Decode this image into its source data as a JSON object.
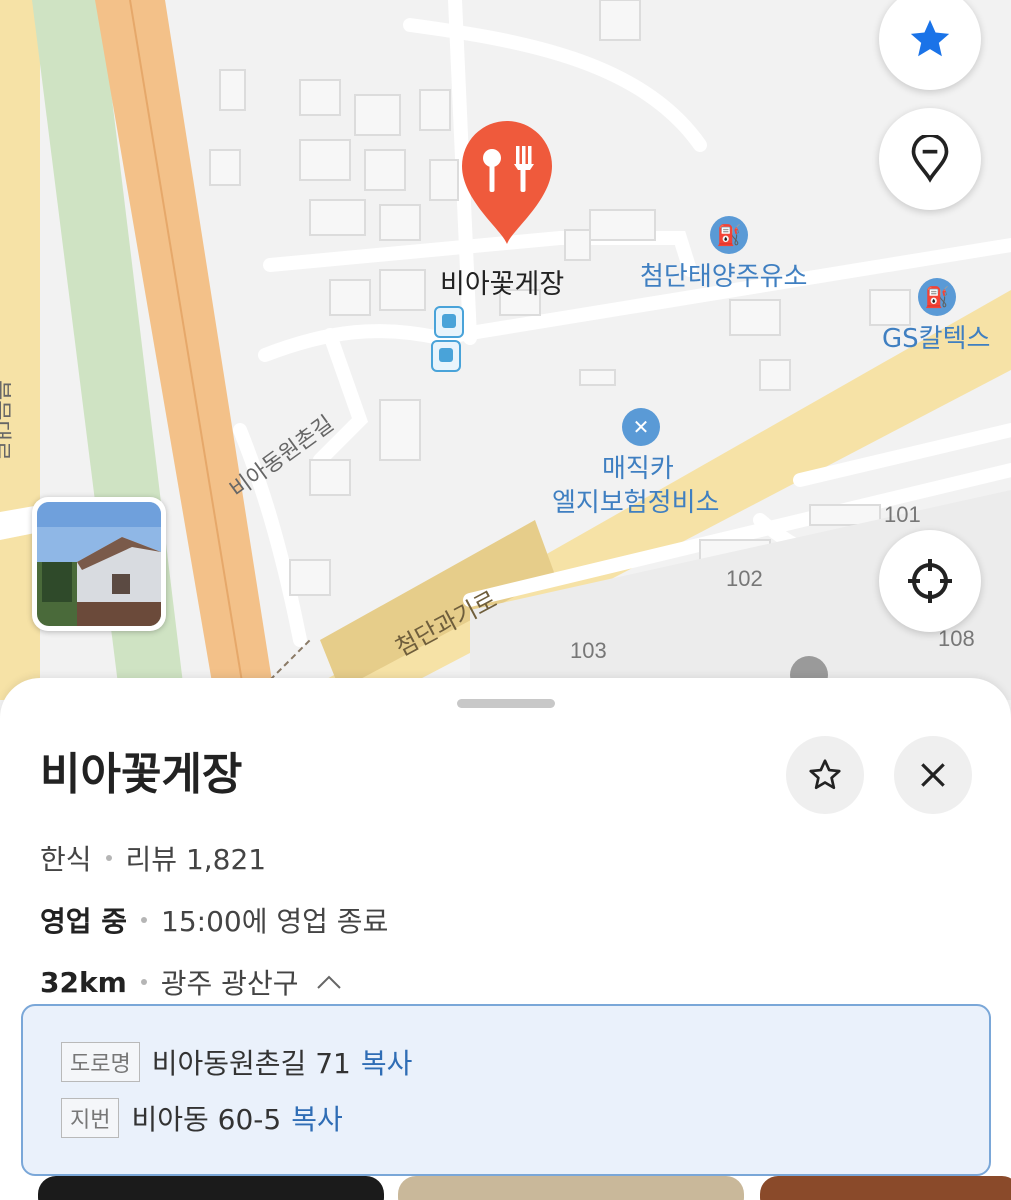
{
  "map": {
    "marker_label": "비아꽃게장",
    "pois": [
      {
        "name": "첨단태양주유소",
        "icon": "gas-station-icon"
      },
      {
        "name": "GS칼텍스",
        "icon": "gas-station-icon"
      },
      {
        "name_line1": "매직카",
        "name_line2": "엘지보험정비소",
        "icon": "repair-icon"
      }
    ],
    "roads": {
      "bukmundaero": "북문대로",
      "biadong": "비아동원촌길",
      "cheomdan": "첨단과기로"
    },
    "building_numbers": [
      "101",
      "102",
      "103",
      "108"
    ],
    "colors": {
      "marker": "#ef5a3c",
      "accent_blue": "#1a73e8"
    }
  },
  "sheet": {
    "title": "비아꽃게장",
    "category": "한식",
    "review_label": "리뷰 1,821",
    "status": "영업 중",
    "hours": "15:00에 영업 종료",
    "distance": "32km",
    "region": "광주 광산구",
    "address": {
      "road_tag": "도로명",
      "road_value": "비아동원촌길 71",
      "lot_tag": "지번",
      "lot_value": "비아동 60-5",
      "copy_label": "복사"
    }
  }
}
